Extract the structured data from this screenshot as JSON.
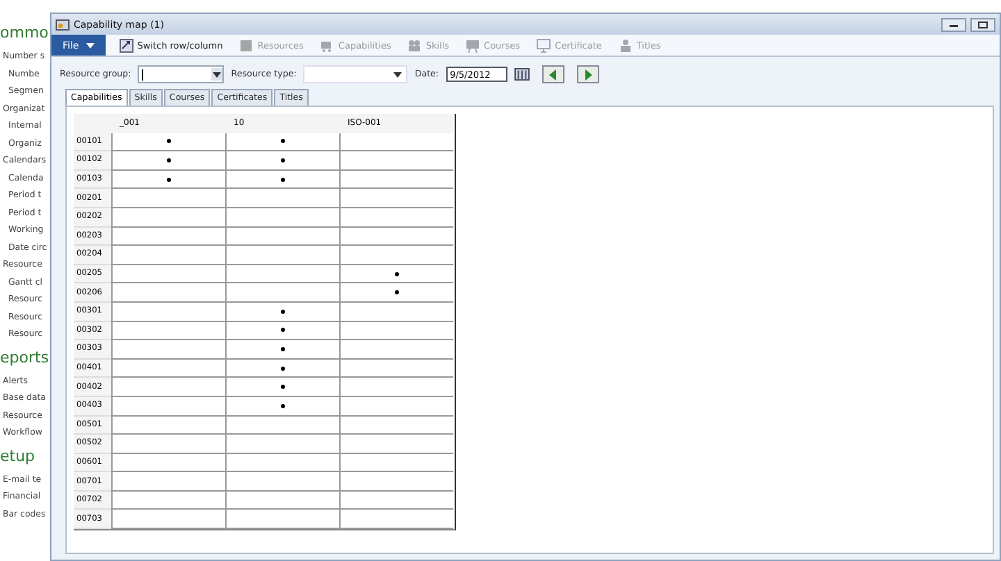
{
  "nav": [
    {
      "heading": "ommo",
      "items": [
        {
          "label": "Number s",
          "children": [
            {
              "label": "Numbe"
            },
            {
              "label": "Segmen"
            }
          ]
        },
        {
          "label": "Organizat",
          "children": [
            {
              "label": "Internal"
            },
            {
              "label": "Organiz"
            }
          ]
        },
        {
          "label": "Calendars",
          "children": [
            {
              "label": "Calenda"
            },
            {
              "label": "Period t"
            },
            {
              "label": "Period t"
            },
            {
              "label": "Working"
            },
            {
              "label": "Date circ"
            }
          ]
        },
        {
          "label": "Resource",
          "children": [
            {
              "label": "Gantt cl"
            },
            {
              "label": "Resourc"
            },
            {
              "label": "Resourc"
            },
            {
              "label": "Resourc"
            }
          ]
        }
      ]
    },
    {
      "heading": "eports",
      "items": [
        {
          "label": "Alerts"
        },
        {
          "label": "Base data"
        },
        {
          "label": "Resource"
        },
        {
          "label": "Workflow"
        }
      ]
    },
    {
      "heading": "etup",
      "items": [
        {
          "label": "E-mail te"
        },
        {
          "label": "Financial"
        },
        {
          "label": "Bar codes"
        }
      ]
    }
  ],
  "window": {
    "title": "Capability map (1)"
  },
  "toolbar": [
    {
      "kind": "menu",
      "label": "File"
    },
    {
      "kind": "button",
      "label": "Switch row/column",
      "disabled": false
    },
    {
      "kind": "button",
      "label": "Resources",
      "disabled": true
    },
    {
      "kind": "button",
      "label": "Capabilities",
      "disabled": true
    },
    {
      "kind": "button",
      "label": "Skills",
      "disabled": true
    },
    {
      "kind": "button",
      "label": "Courses",
      "disabled": true
    },
    {
      "kind": "button",
      "label": "Certificate",
      "disabled": true
    },
    {
      "kind": "button",
      "label": "Titles",
      "disabled": true
    }
  ],
  "filters": {
    "resource_group": {
      "label": "Resource group:"
    },
    "resource_type": {
      "label": "Resource type:"
    },
    "date": {
      "label": "Date:",
      "value": "9/5/2012"
    }
  },
  "tabs": [
    {
      "label": "Capabilities",
      "selected": true
    },
    {
      "label": "Skills",
      "selected": false
    },
    {
      "label": "Courses",
      "selected": false
    },
    {
      "label": "Certificates",
      "selected": false
    },
    {
      "label": "Titles",
      "selected": false
    }
  ],
  "grid": {
    "columns": [
      "_001",
      "10",
      "ISO-001"
    ],
    "rows": [
      {
        "id": "00101",
        "marks": [
          true,
          true,
          false
        ]
      },
      {
        "id": "00102",
        "marks": [
          true,
          true,
          false
        ]
      },
      {
        "id": "00103",
        "marks": [
          true,
          true,
          false
        ]
      },
      {
        "id": "00201",
        "marks": [
          false,
          false,
          false
        ]
      },
      {
        "id": "00202",
        "marks": [
          false,
          false,
          false
        ]
      },
      {
        "id": "00203",
        "marks": [
          false,
          false,
          false
        ]
      },
      {
        "id": "00204",
        "marks": [
          false,
          false,
          false
        ]
      },
      {
        "id": "00205",
        "marks": [
          false,
          false,
          true
        ]
      },
      {
        "id": "00206",
        "marks": [
          false,
          false,
          true
        ]
      },
      {
        "id": "00301",
        "marks": [
          false,
          true,
          false
        ]
      },
      {
        "id": "00302",
        "marks": [
          false,
          true,
          false
        ]
      },
      {
        "id": "00303",
        "marks": [
          false,
          true,
          false
        ]
      },
      {
        "id": "00401",
        "marks": [
          false,
          true,
          false
        ]
      },
      {
        "id": "00402",
        "marks": [
          false,
          true,
          false
        ]
      },
      {
        "id": "00403",
        "marks": [
          false,
          true,
          false
        ]
      },
      {
        "id": "00501",
        "marks": [
          false,
          false,
          false
        ]
      },
      {
        "id": "00502",
        "marks": [
          false,
          false,
          false
        ]
      },
      {
        "id": "00601",
        "marks": [
          false,
          false,
          false
        ]
      },
      {
        "id": "00701",
        "marks": [
          false,
          false,
          false
        ]
      },
      {
        "id": "00702",
        "marks": [
          false,
          false,
          false
        ]
      },
      {
        "id": "00703",
        "marks": [
          false,
          false,
          false
        ]
      }
    ]
  }
}
